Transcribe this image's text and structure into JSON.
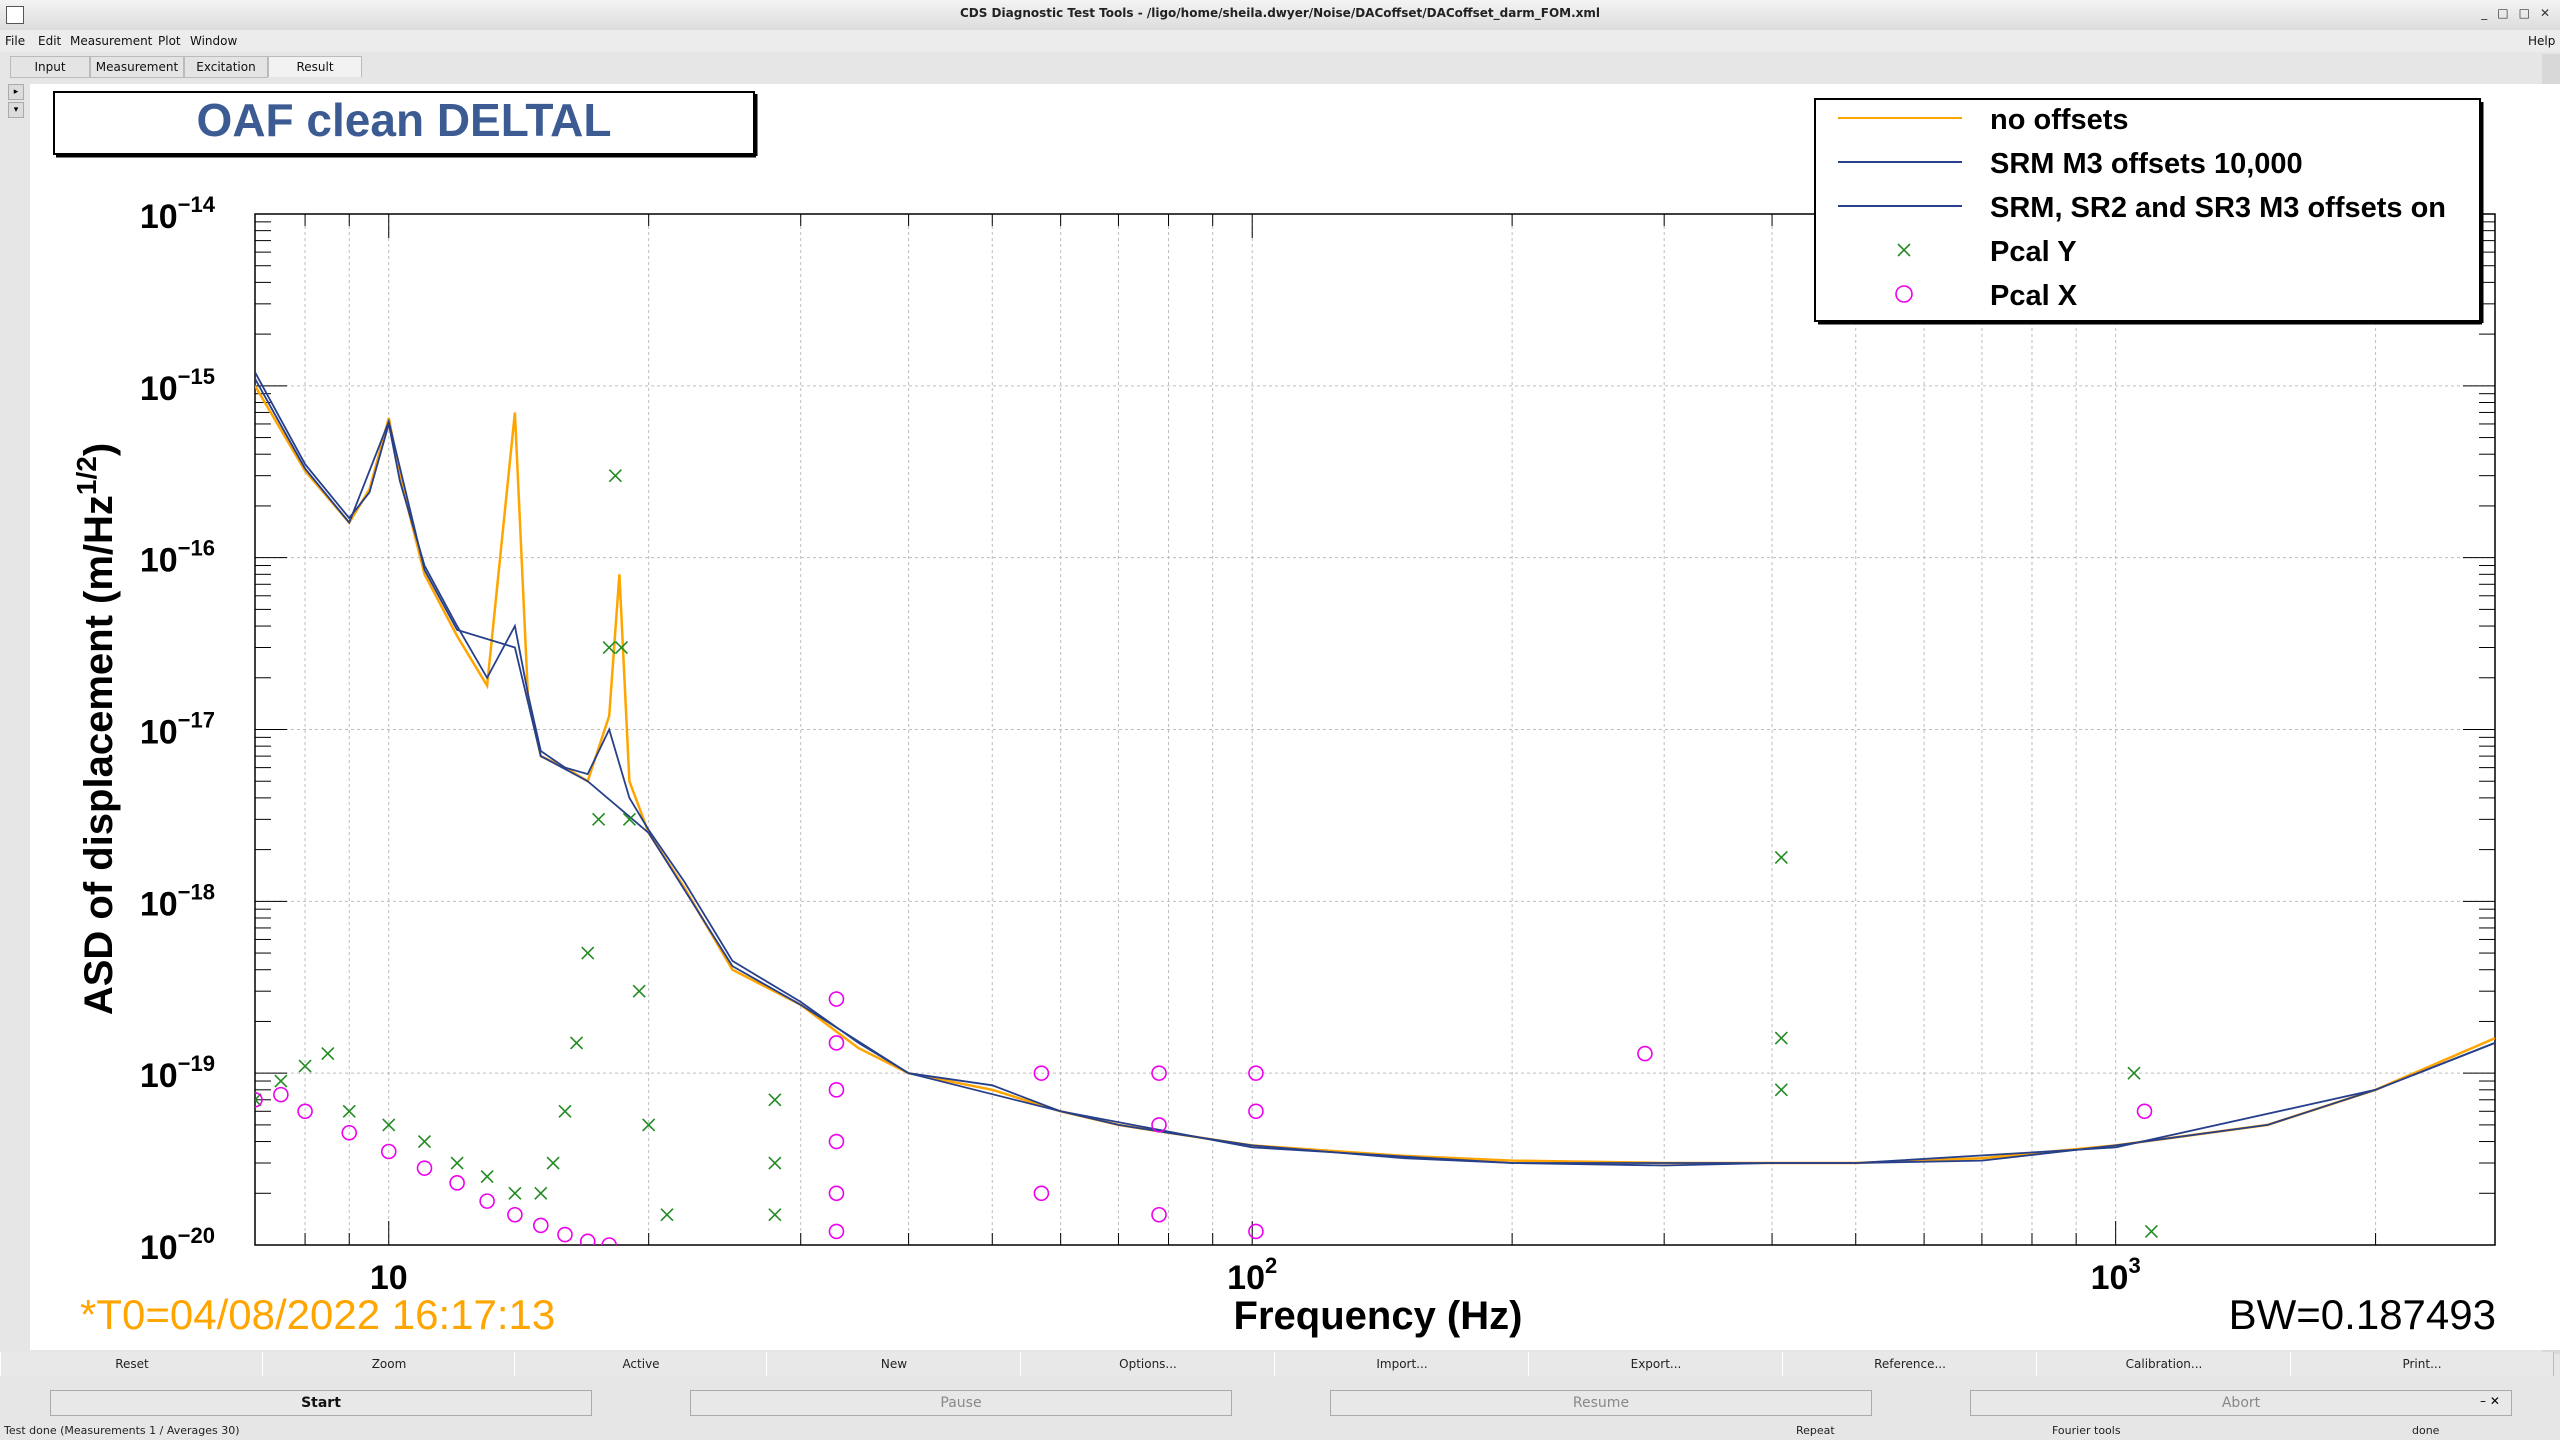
{
  "window": {
    "title": "CDS Diagnostic Test Tools - /ligo/home/sheila.dwyer/Noise/DACoffset/DACoffset_darm_FOM.xml",
    "controls": [
      "_",
      "□",
      "□",
      "✕"
    ]
  },
  "menu": [
    "File",
    "Edit",
    "Measurement",
    "Plot",
    "Window"
  ],
  "help_label": "Help",
  "tabs": [
    "Input",
    "Measurement",
    "Excitation",
    "Result"
  ],
  "plot": {
    "title": "OAF clean DELTAL",
    "timestamp": "*T0=04/08/2022 16:17:13",
    "bw": "BW=0.187493",
    "xlabel": "Frequency (Hz)",
    "ylabel": "ASD of displacement (m/Hz",
    "ylabel_exp": "1/2",
    "ylabel_close": ")"
  },
  "chart_data": {
    "type": "line",
    "xscale": "log",
    "yscale": "log",
    "xlim": [
      7,
      2750
    ],
    "ylim": [
      1e-20,
      1e-14
    ],
    "x_ticks": [
      {
        "base": "10",
        "exp": ""
      },
      {
        "base": "10",
        "exp": "2"
      },
      {
        "base": "10",
        "exp": "3"
      }
    ],
    "y_ticks": [
      {
        "base": "10",
        "exp": "−14"
      },
      {
        "base": "10",
        "exp": "−15"
      },
      {
        "base": "10",
        "exp": "−16"
      },
      {
        "base": "10",
        "exp": "−17"
      },
      {
        "base": "10",
        "exp": "−18"
      },
      {
        "base": "10",
        "exp": "−19"
      },
      {
        "base": "10",
        "exp": "−20"
      }
    ],
    "grid": true,
    "legend_position": "top-right",
    "series": [
      {
        "name": "no offsets",
        "color": "#ffa500",
        "style": "line",
        "points": [
          [
            7,
            1e-15
          ],
          [
            8,
            3.2e-16
          ],
          [
            9,
            1.6e-16
          ],
          [
            9.5,
            2.5e-16
          ],
          [
            10,
            6.5e-16
          ],
          [
            10.3,
            3e-16
          ],
          [
            11,
            8e-17
          ],
          [
            12,
            3.5e-17
          ],
          [
            13,
            1.8e-17
          ],
          [
            14,
            7e-16
          ],
          [
            14.5,
            1.5e-17
          ],
          [
            15,
            7e-18
          ],
          [
            16,
            6e-18
          ],
          [
            17,
            5e-18
          ],
          [
            18,
            1.2e-17
          ],
          [
            18.5,
            8e-17
          ],
          [
            19,
            5e-18
          ],
          [
            20,
            2.5e-18
          ],
          [
            22,
            1.2e-18
          ],
          [
            25,
            4e-19
          ],
          [
            30,
            2.5e-19
          ],
          [
            35,
            1.4e-19
          ],
          [
            40,
            1e-19
          ],
          [
            50,
            8e-20
          ],
          [
            60,
            6e-20
          ],
          [
            70,
            5e-20
          ],
          [
            80,
            4.5e-20
          ],
          [
            100,
            3.8e-20
          ],
          [
            150,
            3.3e-20
          ],
          [
            200,
            3.1e-20
          ],
          [
            300,
            3e-20
          ],
          [
            400,
            3e-20
          ],
          [
            500,
            3e-20
          ],
          [
            700,
            3.2e-20
          ],
          [
            1000,
            3.8e-20
          ],
          [
            1500,
            5e-20
          ],
          [
            2000,
            8e-20
          ],
          [
            2750,
            1.6e-19
          ]
        ]
      },
      {
        "name": "SRM M3 offsets 10,000",
        "color": "#27408b",
        "style": "line",
        "points": [
          [
            7,
            1.2e-15
          ],
          [
            8,
            3.5e-16
          ],
          [
            9,
            1.7e-16
          ],
          [
            9.5,
            2.4e-16
          ],
          [
            10,
            6e-16
          ],
          [
            10.3,
            2.8e-16
          ],
          [
            11,
            9e-17
          ],
          [
            12,
            4e-17
          ],
          [
            13,
            2e-17
          ],
          [
            14,
            4e-17
          ],
          [
            14.5,
            1.6e-17
          ],
          [
            15,
            7.5e-18
          ],
          [
            16,
            6e-18
          ],
          [
            17,
            5.5e-18
          ],
          [
            18,
            1e-17
          ],
          [
            19,
            4e-18
          ],
          [
            20,
            2.6e-18
          ],
          [
            22,
            1.3e-18
          ],
          [
            25,
            4.5e-19
          ],
          [
            30,
            2.6e-19
          ],
          [
            35,
            1.5e-19
          ],
          [
            40,
            1e-19
          ],
          [
            50,
            8.5e-20
          ],
          [
            60,
            6e-20
          ],
          [
            70,
            5e-20
          ],
          [
            80,
            4.5e-20
          ],
          [
            100,
            3.8e-20
          ],
          [
            150,
            3.2e-20
          ],
          [
            200,
            3e-20
          ],
          [
            300,
            2.9e-20
          ],
          [
            400,
            3e-20
          ],
          [
            500,
            3e-20
          ],
          [
            700,
            3.1e-20
          ],
          [
            1000,
            3.8e-20
          ],
          [
            1500,
            5e-20
          ],
          [
            2000,
            8e-20
          ],
          [
            2750,
            1.5e-19
          ]
        ]
      },
      {
        "name": "SRM, SR2 and SR3 M3 offsets on",
        "color": "#27408b",
        "style": "line",
        "points": [
          [
            7,
            1.1e-15
          ],
          [
            8,
            3.3e-16
          ],
          [
            9,
            1.6e-16
          ],
          [
            10,
            6.2e-16
          ],
          [
            11,
            8.5e-17
          ],
          [
            12,
            3.8e-17
          ],
          [
            14,
            3e-17
          ],
          [
            15,
            7e-18
          ],
          [
            17,
            5e-18
          ],
          [
            20,
            2.5e-18
          ],
          [
            25,
            4.2e-19
          ],
          [
            30,
            2.5e-19
          ],
          [
            40,
            1e-19
          ],
          [
            60,
            6e-20
          ],
          [
            100,
            3.7e-20
          ],
          [
            200,
            3e-20
          ],
          [
            500,
            3e-20
          ],
          [
            1000,
            3.7e-20
          ],
          [
            2000,
            8e-20
          ],
          [
            2750,
            1.5e-19
          ]
        ]
      },
      {
        "name": "Pcal Y",
        "color": "#228b22",
        "style": "x",
        "points": [
          [
            7,
            7e-20
          ],
          [
            7.5,
            9e-20
          ],
          [
            8,
            1.1e-19
          ],
          [
            8.5,
            1.3e-19
          ],
          [
            9,
            6e-20
          ],
          [
            10,
            5e-20
          ],
          [
            11,
            4e-20
          ],
          [
            12,
            3e-20
          ],
          [
            13,
            2.5e-20
          ],
          [
            14,
            2e-20
          ],
          [
            15,
            2e-20
          ],
          [
            15.5,
            3e-20
          ],
          [
            16,
            6e-20
          ],
          [
            16.5,
            1.5e-19
          ],
          [
            17,
            5e-19
          ],
          [
            17.5,
            3e-18
          ],
          [
            18,
            3e-17
          ],
          [
            18.3,
            3e-16
          ],
          [
            18.6,
            3e-17
          ],
          [
            19,
            3e-18
          ],
          [
            19.5,
            3e-19
          ],
          [
            20,
            5e-20
          ],
          [
            21,
            1.5e-20
          ],
          [
            28,
            7e-20
          ],
          [
            28,
            3e-20
          ],
          [
            28,
            1.5e-20
          ],
          [
            410,
            1.8e-18
          ],
          [
            410,
            1.6e-19
          ],
          [
            410,
            8e-20
          ],
          [
            1050,
            1e-19
          ],
          [
            1100,
            1.2e-20
          ]
        ]
      },
      {
        "name": "Pcal X",
        "color": "#ee00ee",
        "style": "o",
        "points": [
          [
            7,
            7e-20
          ],
          [
            7.5,
            7.5e-20
          ],
          [
            8,
            6e-20
          ],
          [
            9,
            4.5e-20
          ],
          [
            10,
            3.5e-20
          ],
          [
            11,
            2.8e-20
          ],
          [
            12,
            2.3e-20
          ],
          [
            13,
            1.8e-20
          ],
          [
            14,
            1.5e-20
          ],
          [
            15,
            1.3e-20
          ],
          [
            16,
            1.15e-20
          ],
          [
            17,
            1.05e-20
          ],
          [
            18,
            1e-20
          ],
          [
            33,
            2.7e-19
          ],
          [
            33,
            1.5e-19
          ],
          [
            33,
            8e-20
          ],
          [
            33,
            4e-20
          ],
          [
            33,
            2e-20
          ],
          [
            33,
            1.2e-20
          ],
          [
            57,
            1e-19
          ],
          [
            57,
            2e-20
          ],
          [
            78,
            1e-19
          ],
          [
            78,
            5e-20
          ],
          [
            78,
            1.5e-20
          ],
          [
            101,
            1e-19
          ],
          [
            101,
            6e-20
          ],
          [
            101,
            1.2e-20
          ],
          [
            285,
            1.3e-19
          ],
          [
            1080,
            6e-20
          ]
        ]
      }
    ]
  },
  "bottom_buttons": [
    "Reset",
    "Zoom",
    "Active",
    "New",
    "Options...",
    "Import...",
    "Export...",
    "Reference...",
    "Calibration...",
    "Print..."
  ],
  "control_buttons": {
    "start": "Start",
    "pause": "Pause",
    "resume": "Resume",
    "abort": "Abort"
  },
  "status": {
    "left": "Test done (Measurements 1 / Averages 30)",
    "repeat": "Repeat",
    "fourier": "Fourier tools",
    "done": "done"
  }
}
